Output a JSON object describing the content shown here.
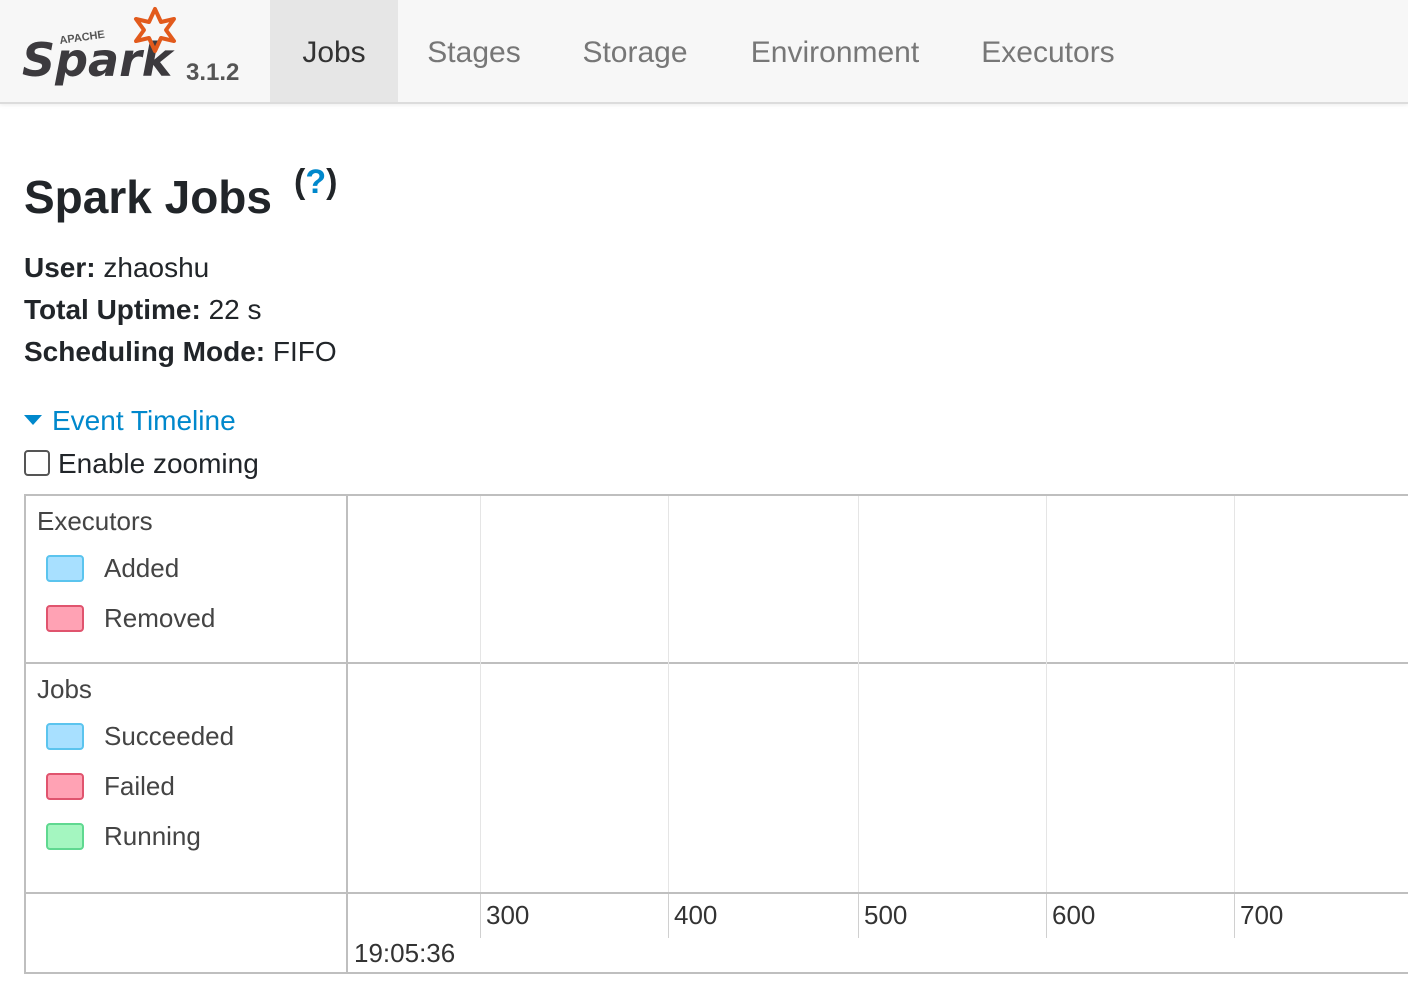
{
  "brand": {
    "logo_text": "Spark",
    "logo_superscript": "APACHE",
    "version": "3.1.2"
  },
  "nav": {
    "tabs": [
      {
        "label": "Jobs",
        "active": true
      },
      {
        "label": "Stages",
        "active": false
      },
      {
        "label": "Storage",
        "active": false
      },
      {
        "label": "Environment",
        "active": false
      },
      {
        "label": "Executors",
        "active": false
      }
    ]
  },
  "page": {
    "title": "Spark Jobs",
    "help_open": "(",
    "help_q": "?",
    "help_close": ")",
    "user_label": "User:",
    "user_value": "zhaoshu",
    "uptime_label": "Total Uptime:",
    "uptime_value": "22 s",
    "mode_label": "Scheduling Mode:",
    "mode_value": "FIFO"
  },
  "timeline": {
    "toggle_label": "Event Timeline",
    "zoom_label": "Enable zooming",
    "zoom_checked": false,
    "groups": [
      {
        "title": "Executors",
        "legend": [
          {
            "label": "Added",
            "fill": "#a8e0ff",
            "border": "#5bc4ee"
          },
          {
            "label": "Removed",
            "fill": "#ffa2b4",
            "border": "#e0546e"
          }
        ]
      },
      {
        "title": "Jobs",
        "legend": [
          {
            "label": "Succeeded",
            "fill": "#a8e0ff",
            "border": "#5bc4ee"
          },
          {
            "label": "Failed",
            "fill": "#ffa2b4",
            "border": "#e0546e"
          },
          {
            "label": "Running",
            "fill": "#a4f6c0",
            "border": "#5fd890"
          }
        ]
      }
    ],
    "axis": {
      "ticks": [
        "300",
        "400",
        "500",
        "600",
        "700"
      ],
      "start_time": "19:05:36"
    }
  }
}
